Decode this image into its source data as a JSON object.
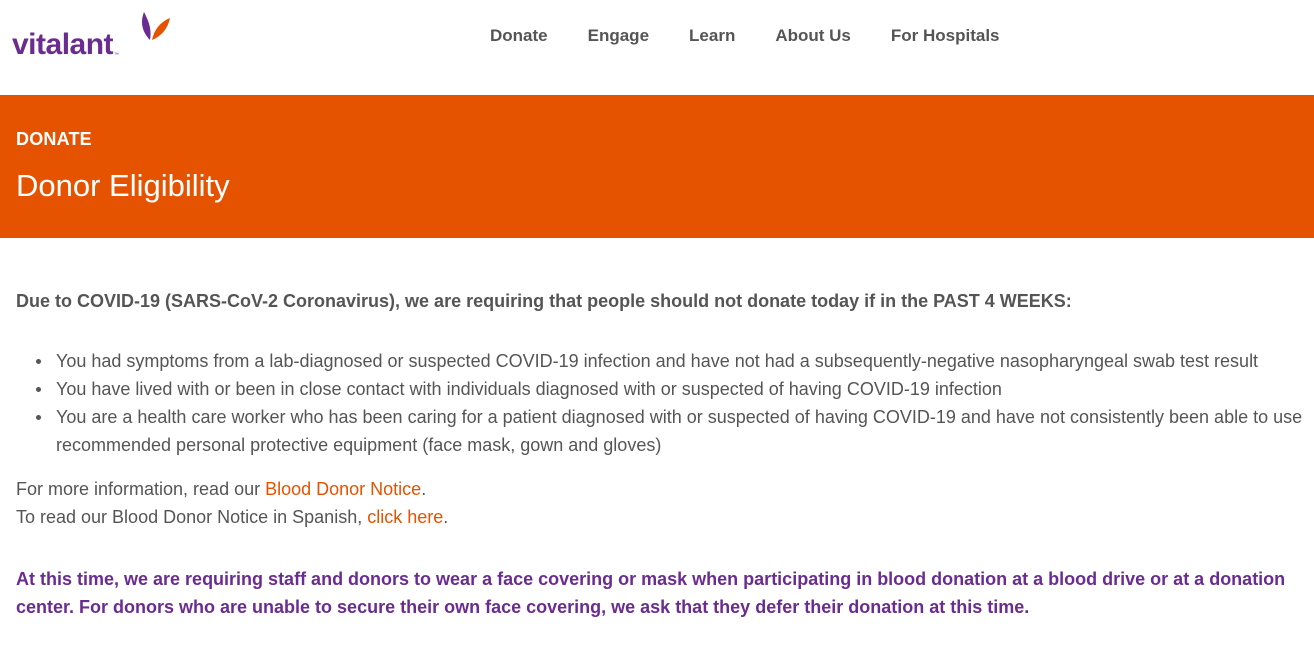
{
  "brand": {
    "name": "vitalant",
    "tm": "™",
    "purple": "#6b2c91",
    "orange": "#e55300"
  },
  "nav": {
    "items": [
      "Donate",
      "Engage",
      "Learn",
      "About Us",
      "For Hospitals"
    ]
  },
  "banner": {
    "crumb": "DONATE",
    "title": "Donor Eligibility"
  },
  "content": {
    "lead": "Due to COVID-19 (SARS-CoV-2 Coronavirus), we are requiring that people should not donate today if in the PAST 4 WEEKS:",
    "reasons": [
      "You had symptoms from a lab-diagnosed or suspected COVID-19 infection and have not had a subsequently-negative nasopharyngeal swab test result",
      "You have lived with or been in close contact with individuals diagnosed with or suspected of having COVID-19 infection",
      "You are a health care worker who has been caring for a patient diagnosed with or suspected of having COVID-19 and have not consistently been able to use recommended personal protective equipment (face mask, gown and gloves)"
    ],
    "info_line1_prefix": "For more information, read our ",
    "info_line1_link": "Blood Donor Notice",
    "info_line1_suffix": ".",
    "info_line2_prefix": "To read our Blood Donor Notice in Spanish, ",
    "info_line2_link": "click here",
    "info_line2_suffix": ".",
    "notice": "At this time, we are requiring staff and donors to wear a face covering or mask when participating in blood donation at a blood drive or at a donation center. For donors who are unable to secure their own face covering, we ask that they defer their donation at this time."
  }
}
